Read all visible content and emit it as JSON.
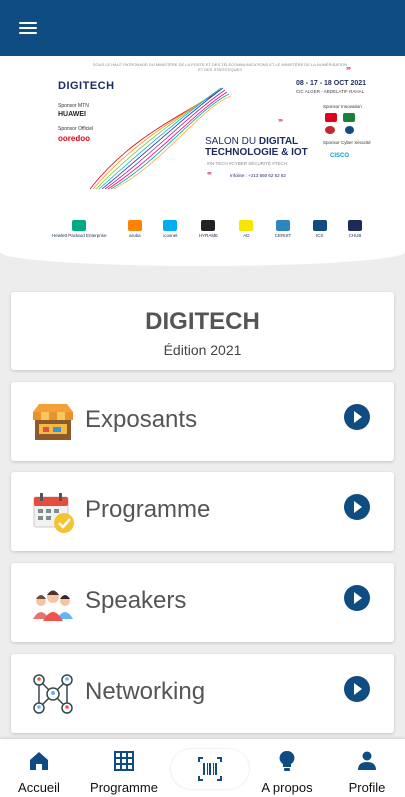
{
  "app_bar": {
    "menu_icon": "hamburger-menu-icon",
    "color": "#0f4c81"
  },
  "banner": {
    "top_line": "SOUS LE HAUT PATRONAGE DU MINISTÈRE DE LA POSTE ET DES TÉLÉCOMMUNICATIONS ET LE MINISTÈRE DE LA NUMÉRISATION ET DES STATISTIQUES",
    "logo": "DIGITECH",
    "sponsor_mtn_label": "Sponsor MTN",
    "sponsor_mtn": "HUAWEI",
    "sponsor_official_label": "Sponsor Officiel",
    "sponsor_official": "ooredoo",
    "dates": "08 - 17 - 18 OCT 2021",
    "venue": "CIC ALGER - ABDELATIF RAHAL",
    "salon_line1": "SALON DU",
    "salon_line2": "DIGITAL TECHNOLOGIE & IOT",
    "tags": "#IN-TECH   #CYBER SÉCURITÉ   #TECH",
    "phone": "Infoline : +213 550 62 62 62",
    "sponsor_innovation_label": "Sponsor Innovation",
    "sponsor_cyber_label": "Sponsor Cyber Sécurité",
    "sponsor_cyber": "CISCO",
    "partners": [
      "Hewlett Packard Enterprise",
      "aruba",
      "icosnet",
      "HYRAME",
      "AD",
      "CERIST",
      "ICS",
      "CHUB"
    ]
  },
  "event": {
    "title": "DIGITECH",
    "edition": "Édition 2021"
  },
  "menu": [
    {
      "label": "Exposants",
      "icon": "exhibitor-stand-icon",
      "action_icon": "chevron-right-circle-icon"
    },
    {
      "label": "Programme",
      "icon": "calendar-check-icon",
      "action_icon": "chevron-right-circle-icon"
    },
    {
      "label": "Speakers",
      "icon": "speakers-group-icon",
      "action_icon": "chevron-right-circle-icon"
    },
    {
      "label": "Networking",
      "icon": "network-people-icon",
      "action_icon": "chevron-right-circle-icon"
    }
  ],
  "bottom_nav": {
    "home": {
      "label": "Accueil",
      "icon": "home-icon"
    },
    "programme": {
      "label": "Programme",
      "icon": "grid-icon"
    },
    "scan": {
      "icon": "barcode-scan-icon"
    },
    "about": {
      "label": "A propos",
      "icon": "lightbulb-icon"
    },
    "profile": {
      "label": "Profile",
      "icon": "person-icon"
    }
  },
  "colors": {
    "primary": "#0f4c81",
    "background": "#ededed",
    "text": "#555555"
  }
}
